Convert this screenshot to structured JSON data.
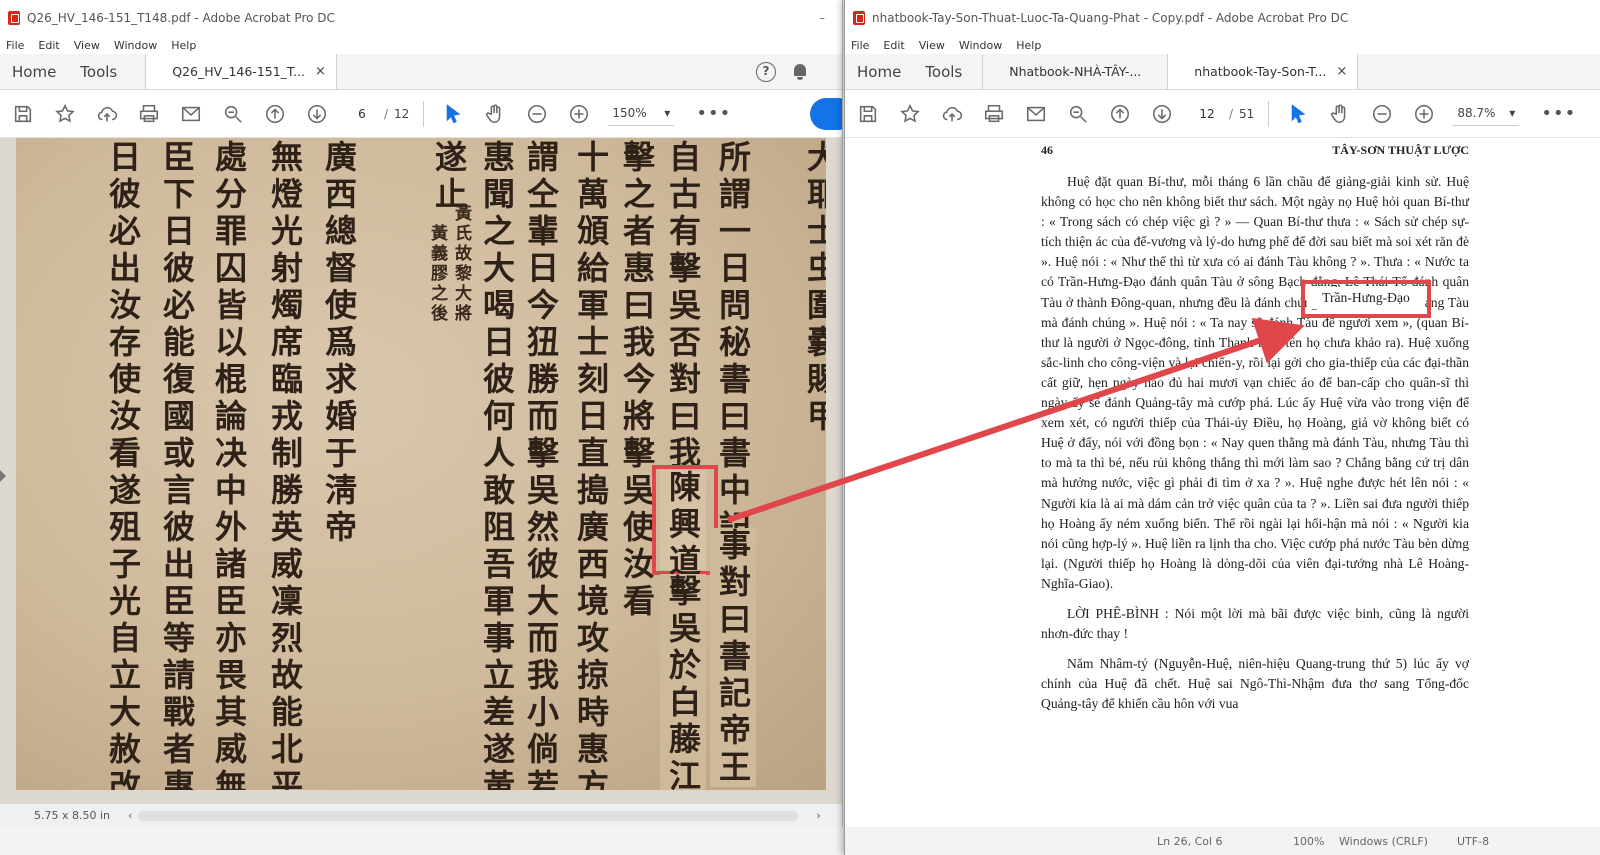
{
  "left_window": {
    "title": "Q26_HV_146-151_T148.pdf - Adobe Acrobat Pro DC",
    "minimize_glyph": "–",
    "menu": [
      "File",
      "Edit",
      "View",
      "Window",
      "Help"
    ],
    "nav": {
      "home": "Home",
      "tools": "Tools"
    },
    "tabs": [
      {
        "label": "Q26_HV_146-151_T...",
        "close": "×"
      }
    ],
    "help_glyph": "?",
    "page": {
      "current": "6",
      "total": "12"
    },
    "zoom": "150%",
    "more": "•••",
    "status_dims": "5.75 x 8.50 in",
    "scroll_left": "‹",
    "scroll_right": "›",
    "scan_columns": [
      "大耶士虫圍嚢賜甲",
      "所謂一日問秘書曰書中記",
      "自古有擊吳否對曰我國",
      "擊之者惠曰我今將擊吳使汝看",
      "十萬頒給軍士刻日直搗廣西境攻掠時惠方",
      "謂仝輩日今狃勝而擊吳然彼大而我小倘若不",
      "惠聞之大喝日彼何人敢阻吾軍事立差遂黃氏",
      "遂止",
      "廣西總督使爲求婚于淸帝",
      "無燈光射燭席臨戎制勝英威凜烈故能北平南",
      "處分罪囚皆以棍論决中外諸臣亦畏其威無敢",
      "臣下日彼必能復國或言彼出臣等請戰者惠日",
      "日彼必出汝存使汝看遂殂子光自立大赦改元"
    ],
    "scan_small_1": "黃氏故黎大將",
    "scan_small_2": "黃義膠之後",
    "hl_chars": "陳興道",
    "tail_chars": "擊吳於白藤江",
    "tail_chars_2": "事對曰書記帝王"
  },
  "right_window": {
    "title": "nhatbook-Tay-Son-Thuat-Luoc-Ta-Quang-Phat - Copy.pdf - Adobe Acrobat Pro DC",
    "menu": [
      "File",
      "Edit",
      "View",
      "Window",
      "Help"
    ],
    "nav": {
      "home": "Home",
      "tools": "Tools"
    },
    "tabs": [
      {
        "label": "Nhatbook-NHÀ-TÂY-...",
        "close": ""
      },
      {
        "label": "nhatbook-Tay-Son-T...",
        "close": "×"
      }
    ],
    "page": {
      "current": "12",
      "total": "51"
    },
    "zoom": "88.7%",
    "more": "•••",
    "page_number": "46",
    "running_head": "TÂY-SƠN   THUẬT LƯỢC",
    "paragraphs": [
      "Huệ đặt quan Bí-thư, mỗi tháng 6 lần chầu để giảng-giải kinh sử. Huệ không có học cho nên không biết thư sách. Một ngày nọ Huệ hỏi quan Bí-thư : « Trong sách có chép việc gì ? » — Quan Bí-thư thưa : « Sách sử chép sự-tích thiện ác của đế-vương và lý-do hưng phế để đời sau biết mà soi xét răn đè ». Huệ nói : « Như thế thì từ xưa có ai đánh Tàu không ? ». Thưa : « Nước ta có Trần-Hưng-Đạo đánh quân Tàu ở sông Bạch-đằng, Lê Thái Tổ đánh quân Tàu ở thành Đông-quan, nhưng đều là đánh chúng, chứ chưa có tiến sang Tàu mà đánh chúng ». Huệ nói : « Ta nay sẽ đánh Tàu để ngươi xem », (quan Bí-thư là người ở Ngọc-đông, tỉnh Thanh-hóa, tên họ chưa khảo ra). Huệ xuống sắc-linh cho công-viện và lại chiến-y, rồi lại gởi cho gia-thiếp của các đại-thần cất giữ, hẹn ngày nào đủ hai mươi vạn chiếc áo để ban-cấp cho quân-sĩ thì ngày ấy sẽ đánh Quảng-tây mà cướp phá. Lúc ấy Huệ vừa vào trong viện để xem xét, có người thiếp của Thái-úy Điều, họ Hoàng, giả vờ không biết có Huệ ở đấy, nói với đồng bọn : « Nay quen thằng mà đánh Tàu, nhưng Tàu thì to mà ta thì bé, nếu rủi không thắng thì mới làm sao ? Chẳng bằng cứ trị dân mà hưởng nước, việc gì phải đi tìm ở xa ? ». Huệ nghe được hét lên nói : « Người kia là ai mà dám cản trở việc quân của ta ? ». Liền sai đưa người thiếp họ Hoàng ấy ném xuống biển. Thế rồi ngài lại hối-hận mà nói : « Người kia nói cũng hợp-lý ». Huệ liền ra lịnh tha cho. Việc cướp phá nước Tàu bèn dừng lại. (Người thiếp họ Hoàng là dòng-dõi của viên đại-tướng nhà Lê Hoàng-Nghĩa-Giao).",
      "LỜI PHÊ-BÌNH : Nói một lời mà bãi được việc binh, cũng là người nhơn-đức thay !",
      "Năm Nhâm-tý (Nguyễn-Huệ, niên-hiệu Quang-trung thứ 5) lúc ấy vợ chính của Huệ đã chết. Huệ sai Ngô-Thì-Nhậm đưa thơ sang Tổng-đốc Quảng-tây để khiến cầu hôn với vua"
    ],
    "highlight_text": "Trần-Hưng-Đạo",
    "status": {
      "pos": "Ln 26, Col 6",
      "zoom": "100%",
      "eol": "Windows (CRLF)",
      "enc": "UTF-8"
    }
  },
  "annotation": {
    "color": "#e0464a"
  }
}
